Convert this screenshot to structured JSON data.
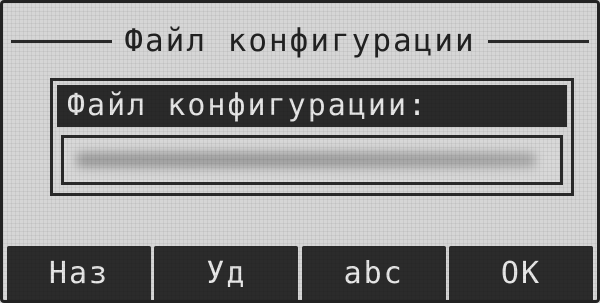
{
  "screen": {
    "title": "Файл конфигурации"
  },
  "field": {
    "label": "Файл конфигурации:",
    "value_obscured": true
  },
  "softkeys": [
    {
      "label": "Наз"
    },
    {
      "label": "Уд"
    },
    {
      "label": "abc"
    },
    {
      "label": "OK"
    }
  ],
  "colors": {
    "background": "#d6d6d6",
    "foreground": "#2a2a2a",
    "inverse_text": "#e6e6e6"
  }
}
